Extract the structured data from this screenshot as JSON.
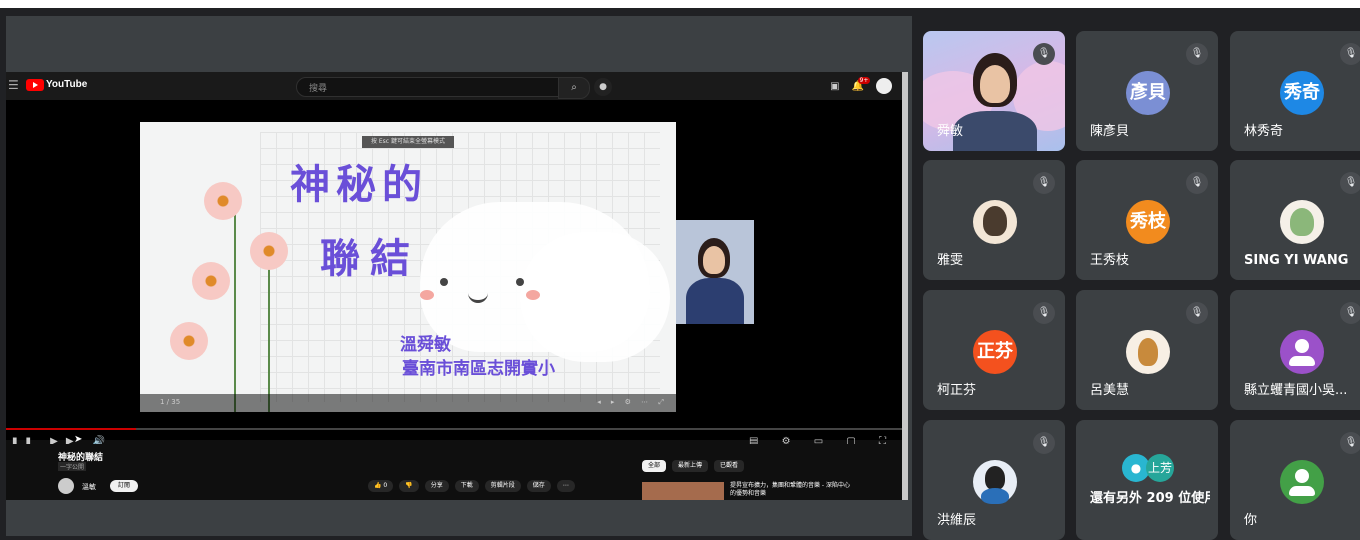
{
  "youtube": {
    "logo": "YouTube",
    "logo_tm": "TW",
    "search_placeholder": "搜尋",
    "notif_count": "9+",
    "video_title": "神秘的聯結",
    "video_subtitle": "一字公開",
    "channel_name": "溫敏",
    "subscribe": "訂閱",
    "likes": "0",
    "actions": [
      "分享",
      "下載",
      "剪輯片段",
      "儲存"
    ],
    "chips": [
      "全部",
      "最新上傳",
      "已觀看"
    ],
    "recommended_title": "提昇宣布擴力，集團和鞏體的音樂 - 深陷中心的優勢和音樂"
  },
  "slide": {
    "caption": "按 Esc 鍵可結束全螢幕模式",
    "title_line1": "神秘的",
    "title_line2": "聯結",
    "author": "溫舜敏",
    "school": "臺南市南區志開實小",
    "page": "1 / 35"
  },
  "participants": [
    {
      "name": "舜敏",
      "type": "camera",
      "muted": true
    },
    {
      "name": "陳彥貝",
      "initials": "彥貝",
      "color": "#7b8fd4",
      "muted": true
    },
    {
      "name": "林秀奇",
      "initials": "秀奇",
      "color": "#1e88e5",
      "muted": true
    },
    {
      "name": "雅雯",
      "type": "photo",
      "muted": true
    },
    {
      "name": "王秀枝",
      "initials": "秀枝",
      "color": "#f28b1e",
      "muted": true
    },
    {
      "name": "SING YI WANG",
      "type": "photo",
      "muted": true
    },
    {
      "name": "柯正芬",
      "initials": "正芬",
      "color": "#f4511e",
      "muted": true
    },
    {
      "name": "呂美慧",
      "type": "photo",
      "muted": true
    },
    {
      "name": "縣立蠼青國小吳...",
      "type": "generic",
      "color": "#9b51c9",
      "muted": true
    },
    {
      "name": "洪維辰",
      "type": "photo",
      "muted": true
    },
    {
      "name": "還有另外 209 位使用者",
      "type": "more",
      "more_initials": "上芳"
    },
    {
      "name": "你",
      "type": "generic",
      "color": "#43a047",
      "muted": true
    }
  ],
  "colors": {
    "accent": "#6a4fd8",
    "tile_bg": "#3c4043",
    "page_bg": "#202124"
  }
}
